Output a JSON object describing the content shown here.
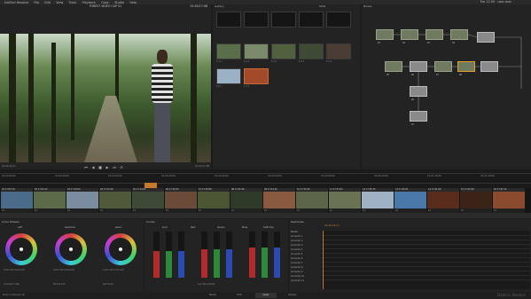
{
  "menubar": {
    "items": [
      "DaVinci Resolve",
      "File",
      "Edit",
      "View",
      "Track",
      "Playback",
      "Color",
      "Studio",
      "Help"
    ],
    "right": "Tue 12:30 · user-mac"
  },
  "viewer": {
    "title": "FOREST VIDEO CLIP 01",
    "timecode": "01:00:17:08",
    "timecode2": "01:00:16:17",
    "transport": [
      "⏮",
      "◀",
      "■",
      "▶",
      "⏭",
      "⟳"
    ]
  },
  "gallery": {
    "title": "Gallery",
    "label": "Stills",
    "stills": [
      "1.1.1",
      "1.2.1",
      "1.3.1",
      "1.4.1",
      "1.5.1",
      "1.6.1",
      "1.7.1"
    ]
  },
  "nodes": {
    "title": "Nodes",
    "labels": [
      "01",
      "02",
      "03",
      "04",
      "05",
      "06",
      "07",
      "08",
      "09",
      "10"
    ]
  },
  "timeline": {
    "timecodes": [
      "01:00:00:00",
      "01:00:10:00",
      "01:00:20:00",
      "01:00:30:00",
      "01:00:40:00",
      "01:00:50:00",
      "01:00:60:00",
      "01:01:00:00",
      "01:01:10:00",
      "01:01:20:00"
    ],
    "clips": [
      {
        "hdr": "01 17:03:10",
        "ftr": "V1"
      },
      {
        "hdr": "02 17:04:12",
        "ftr": "V1"
      },
      {
        "hdr": "03 17:10:04",
        "ftr": "V1"
      },
      {
        "hdr": "04 17:12:20",
        "ftr": "V1"
      },
      {
        "hdr": "05 17:14:01",
        "ftr": "V1"
      },
      {
        "hdr": "06 17:18:33",
        "ftr": "V1"
      },
      {
        "hdr": "07 17:20:08",
        "ftr": "V1"
      },
      {
        "hdr": "08 17:22:40",
        "ftr": "V1"
      },
      {
        "hdr": "09 17:24:10",
        "ftr": "V1"
      },
      {
        "hdr": "10 17:30:44",
        "ftr": "V1"
      },
      {
        "hdr": "11 17:33:02",
        "ftr": "V1"
      },
      {
        "hdr": "12 17:36:15",
        "ftr": "V1"
      },
      {
        "hdr": "13 17:40:21",
        "ftr": "V1"
      },
      {
        "hdr": "14 17:41:09",
        "ftr": "V1"
      },
      {
        "hdr": "15 17:43:30",
        "ftr": "V1"
      },
      {
        "hdr": "16 17:47:12",
        "ftr": "V1"
      }
    ]
  },
  "color_wheels": {
    "title": "Color Wheels",
    "wheels": [
      {
        "label": "Lift",
        "values": "0.00  0.00  0.00  0.00"
      },
      {
        "label": "Gamma",
        "values": "0.00  0.00  0.00  0.00"
      },
      {
        "label": "Gain",
        "values": "1.00  1.00  1.00  1.00"
      }
    ],
    "footer": [
      "Contrast 1.000",
      "Pivot 0.435",
      "Sat 50.00"
    ]
  },
  "curves": {
    "title": "Curves",
    "groups": [
      "Lum",
      "Red",
      "Green",
      "Blue",
      "Soft Clip"
    ],
    "footer": "Lum Mix 100.00"
  },
  "keyframes": {
    "title": "Keyframes",
    "timecode": "01:00:16:17",
    "rows": [
      "Master",
      "Corrector 1",
      "Corrector 2",
      "Corrector 3",
      "Corrector 4",
      "Corrector 5",
      "Corrector 6",
      "Corrector 7",
      "Corrector 8",
      "Corrector 9",
      "Corrector 10",
      "Corrector 11"
    ]
  },
  "status": {
    "left": "DaVinci Resolve 10",
    "tabs": [
      "Media",
      "Edit",
      "Color",
      "Deliver"
    ],
    "active_tab": "Color",
    "brand": "DaVinci Resolve"
  }
}
